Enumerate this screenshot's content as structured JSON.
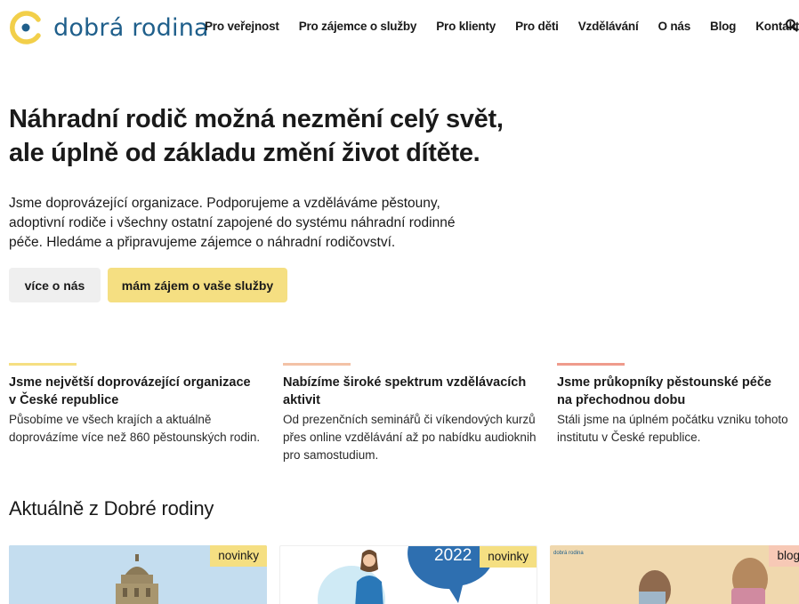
{
  "header": {
    "logo_text": "dobrá rodina",
    "nav": [
      "Pro veřejnost",
      "Pro zájemce o služby",
      "Pro klienty",
      "Pro děti",
      "Vzdělávání",
      "O nás",
      "Blog",
      "Kontakty"
    ],
    "search_icon": "search-icon"
  },
  "hero": {
    "title_lines": [
      "Náhradní rodič možná nezmění celý svět,",
      "ale úplně od základu změní život dítěte."
    ],
    "text_lines": [
      "Jsme doprovázející organizace. Podporujeme a vzděláváme pěstouny,",
      "adoptivní rodiče i všechny ostatní zapojené do systému náhradní rodinné",
      "péče. Hledáme a připravujeme zájemce o náhradní rodičovství."
    ],
    "btn_about": "více o nás",
    "btn_interest": "mám zájem o vaše služby"
  },
  "features": [
    {
      "title_lines": [
        "Jsme největší doprovázející organizace",
        "v České republice"
      ],
      "text_lines": [
        "Působíme ve všech krajích a aktuálně",
        "doprovázíme více než 860 pěstounských rodin."
      ],
      "accent": "#f5df82"
    },
    {
      "title_lines": [
        "Nabízíme široké spektrum vzdělávacích",
        "aktivit"
      ],
      "text_lines": [
        "Od prezenčních seminářů či víkendových kurzů",
        "přes online vzdělávání až po nabídku audioknih",
        "pro samostudium."
      ],
      "accent": "#f3c2a6"
    },
    {
      "title_lines": [
        "Jsme průkopníky pěstounské péče",
        "na přechodnou dobu"
      ],
      "text_lines": [
        "Stáli jsme na úplném počátku vzniku tohoto",
        "institutu v České republice."
      ],
      "accent": "#ef9b8c"
    }
  ],
  "news": {
    "title": "Aktuálně z Dobré rodiny",
    "cards": [
      {
        "tag": "novinky"
      },
      {
        "tag": "novinky",
        "year": "2022"
      },
      {
        "tag": "blog",
        "logo": "dobrá rodina"
      }
    ]
  },
  "colors": {
    "brand_blue": "#1f5f8b",
    "yellow": "#f5df82",
    "logo_yellow": "#f2cf4a"
  }
}
